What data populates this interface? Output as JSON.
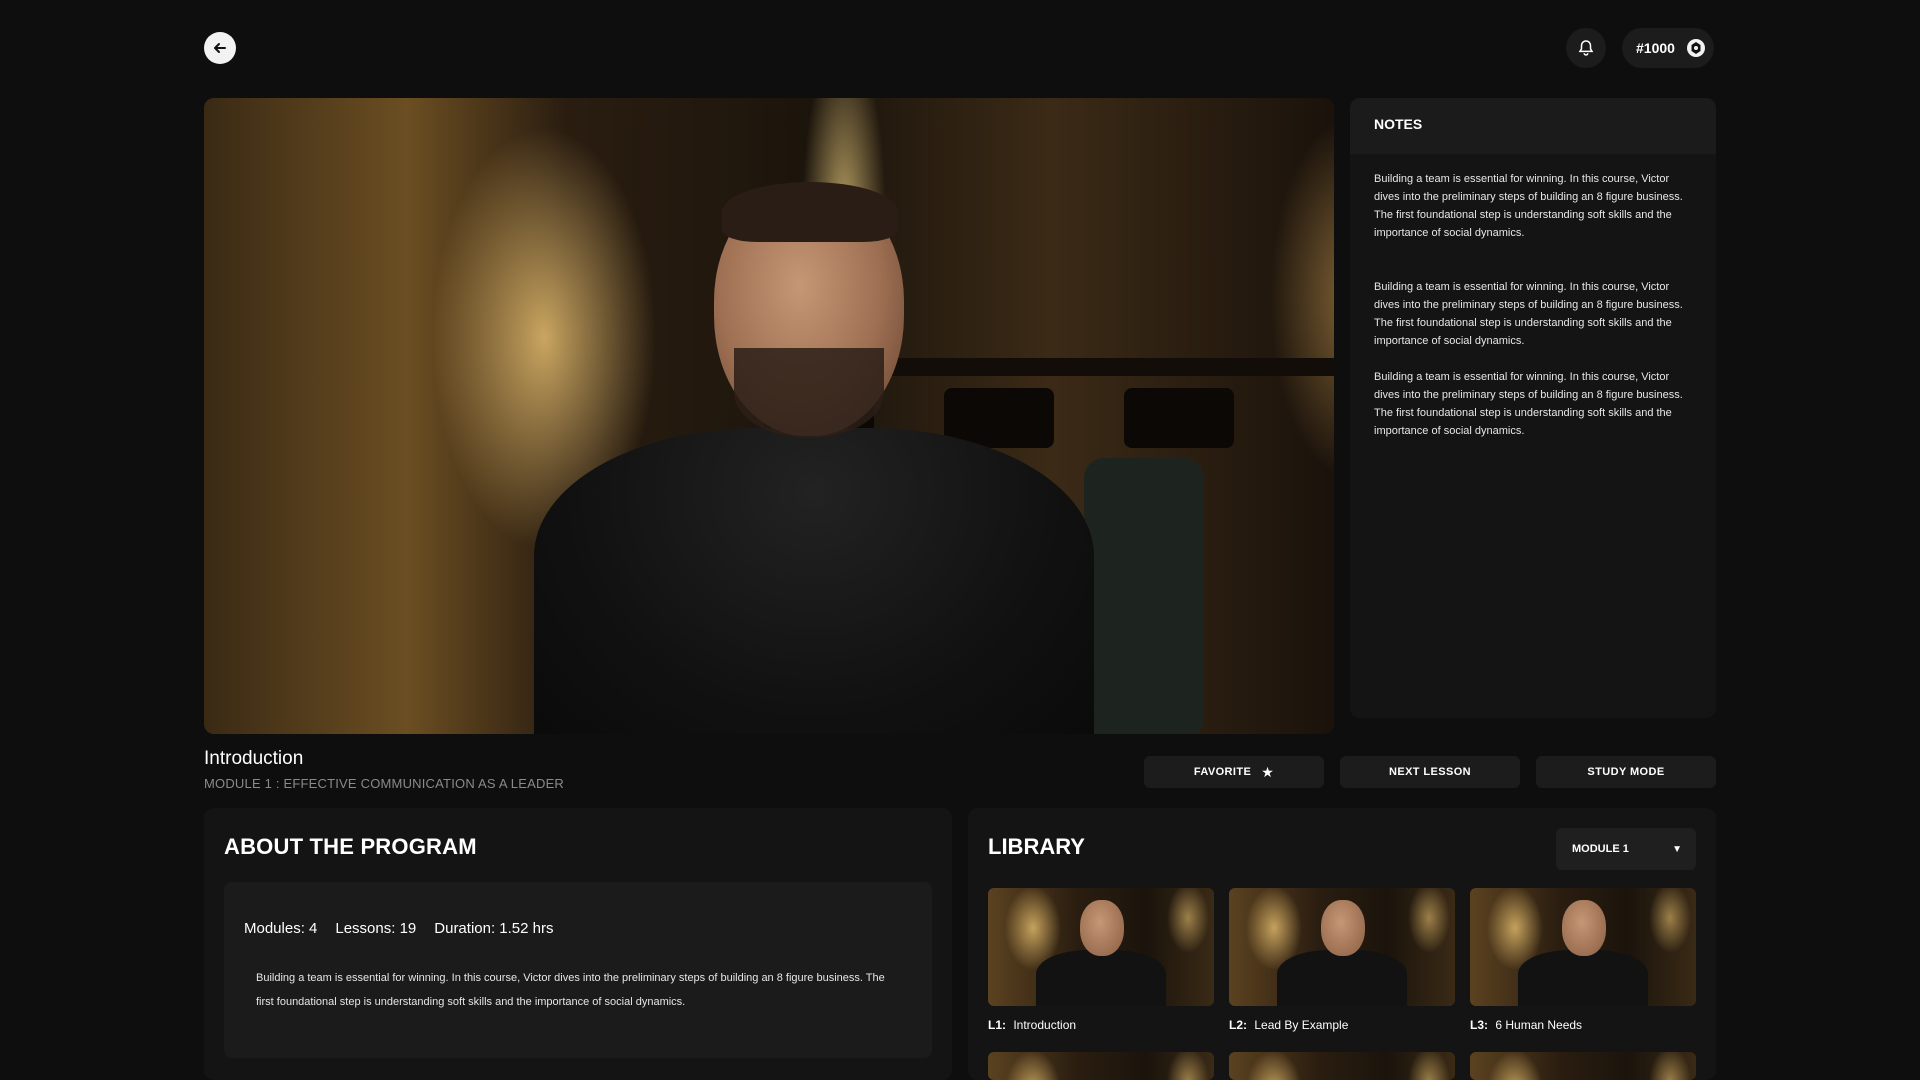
{
  "header": {
    "rank": "#1000",
    "icons": {
      "back": "arrow-left-icon",
      "notifications": "bell-icon",
      "rank": "badge-icon"
    }
  },
  "lesson": {
    "title": "Introduction",
    "module_label": "MODULE 1 : EFFECTIVE COMMUNICATION AS A LEADER"
  },
  "actions": {
    "favorite": "FAVORITE",
    "next_lesson": "NEXT LESSON",
    "study_mode": "STUDY MODE"
  },
  "notes": {
    "title": "NOTES",
    "paragraphs": [
      "Building a team is essential for winning. In this course, Victor dives into the preliminary steps of building an 8 figure business. The first foundational step is understanding soft skills and the importance of social dynamics.",
      "Building a team is essential for winning. In this course, Victor dives into the preliminary steps of building an 8 figure business. The first foundational step is understanding soft skills and the importance of social dynamics.",
      "Building a team is essential for winning. In this course, Victor dives into the preliminary steps of building an 8 figure business. The first foundational step is understanding soft skills and the importance of social dynamics."
    ]
  },
  "about": {
    "title": "ABOUT THE PROGRAM",
    "modules": "Modules: 4",
    "lessons": "Lessons: 19",
    "duration": "Duration: 1.52 hrs",
    "description": "Building a team is essential for winning. In this course, Victor dives into the preliminary steps of building an 8 figure business. The first foundational step is understanding soft skills and the importance of social dynamics."
  },
  "library": {
    "title": "LIBRARY",
    "module_select": "MODULE 1",
    "lessons": [
      {
        "code": "L1:",
        "name": "Introduction"
      },
      {
        "code": "L2:",
        "name": "Lead By Example"
      },
      {
        "code": "L3:",
        "name": "6 Human Needs"
      }
    ]
  },
  "colors": {
    "background": "#0e0e0e",
    "panel": "#141414",
    "button": "#1c1c1c",
    "muted_text": "#8a8a8a"
  }
}
